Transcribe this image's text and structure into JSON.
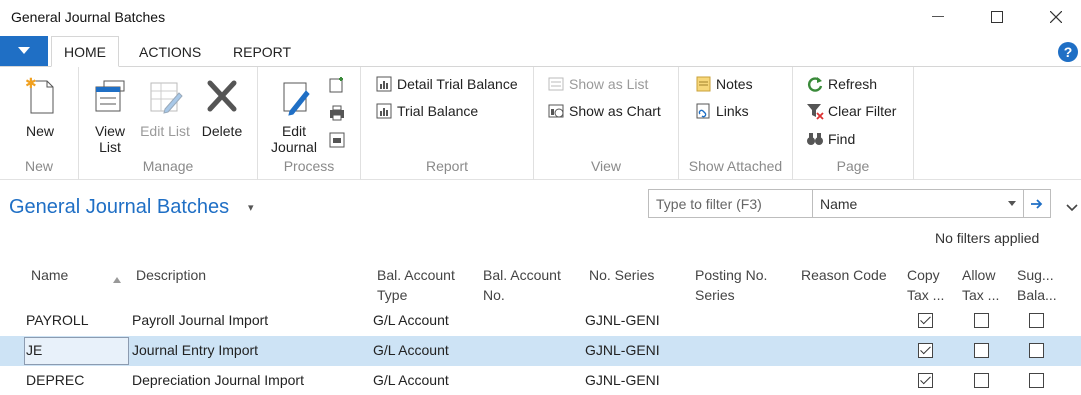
{
  "window": {
    "title": "General Journal Batches"
  },
  "ribbon_tabs": [
    {
      "label": "HOME",
      "active": true
    },
    {
      "label": "ACTIONS",
      "active": false
    },
    {
      "label": "REPORT",
      "active": false
    }
  ],
  "ribbon": {
    "new_group": {
      "label": "New",
      "new": "New"
    },
    "manage_group": {
      "label": "Manage",
      "view_list": "View List",
      "edit_list": "Edit List",
      "delete": "Delete"
    },
    "process_group": {
      "label": "Process",
      "edit_journal": "Edit Journal"
    },
    "report_group": {
      "label": "Report",
      "detail_trial_balance": "Detail Trial Balance",
      "trial_balance": "Trial Balance"
    },
    "view_group": {
      "label": "View",
      "show_as_list": "Show as List",
      "show_as_chart": "Show as Chart"
    },
    "attached_group": {
      "label": "Show Attached",
      "notes": "Notes",
      "links": "Links"
    },
    "page_group": {
      "label": "Page",
      "refresh": "Refresh",
      "clear_filter": "Clear Filter",
      "find": "Find"
    }
  },
  "page": {
    "title": "General Journal Batches",
    "filter_placeholder": "Type to filter (F3)",
    "filter_field": "Name",
    "filter_status": "No filters applied"
  },
  "columns": {
    "name": "Name",
    "description": "Description",
    "bal_account_type_1": "Bal. Account",
    "bal_account_type_2": "Type",
    "bal_account_no_1": "Bal. Account",
    "bal_account_no_2": "No.",
    "no_series": "No. Series",
    "posting_no_series_1": "Posting No.",
    "posting_no_series_2": "Series",
    "reason_code": "Reason Code",
    "copy_tax_1": "Copy",
    "copy_tax_2": "Tax ...",
    "allow_tax_1": "Allow",
    "allow_tax_2": "Tax ...",
    "sug_bal_1": "Sug...",
    "sug_bal_2": "Bala..."
  },
  "rows": [
    {
      "name": "PAYROLL",
      "description": "Payroll Journal Import",
      "bal_account_type": "G/L Account",
      "no_series": "GJNL-GENI",
      "copy_tax": true,
      "allow_tax": false,
      "sug_bal": false
    },
    {
      "name": "JE",
      "description": "Journal Entry Import",
      "bal_account_type": "G/L Account",
      "no_series": "GJNL-GENI",
      "copy_tax": true,
      "allow_tax": false,
      "sug_bal": false
    },
    {
      "name": "DEPREC",
      "description": "Depreciation Journal Import",
      "bal_account_type": "G/L Account",
      "no_series": "GJNL-GENI",
      "copy_tax": true,
      "allow_tax": false,
      "sug_bal": false
    }
  ],
  "colors": {
    "accent": "#1f6fc5",
    "selected_row": "#cde3f5"
  }
}
